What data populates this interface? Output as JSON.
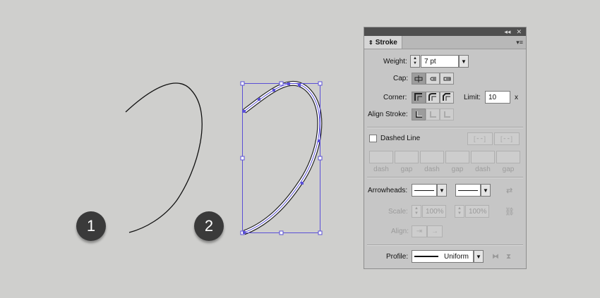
{
  "steps": {
    "one": "1",
    "two": "2"
  },
  "panel": {
    "header_icons": {
      "collapse": "double-left-arrow",
      "close": "x"
    },
    "tab_label": "Stroke",
    "weight": {
      "label": "Weight:",
      "value": "7 pt"
    },
    "cap_label": "Cap:",
    "corner_label": "Corner:",
    "limit": {
      "label": "Limit:",
      "value": "10",
      "unit": "x"
    },
    "align_stroke_label": "Align Stroke:",
    "dashed_line": {
      "label": "Dashed Line",
      "checked": false
    },
    "dash_gap_labels": [
      "dash",
      "gap",
      "dash",
      "gap",
      "dash",
      "gap"
    ],
    "arrowheads_label": "Arrowheads:",
    "scale": {
      "label": "Scale:",
      "start": "100%",
      "end": "100%"
    },
    "align_label": "Align:",
    "profile": {
      "label": "Profile:",
      "value": "Uniform"
    }
  },
  "colors": {
    "selection": "#5a4fd6",
    "panel_bg": "#c6c6c6",
    "canvas_bg": "#cfcfcd"
  }
}
